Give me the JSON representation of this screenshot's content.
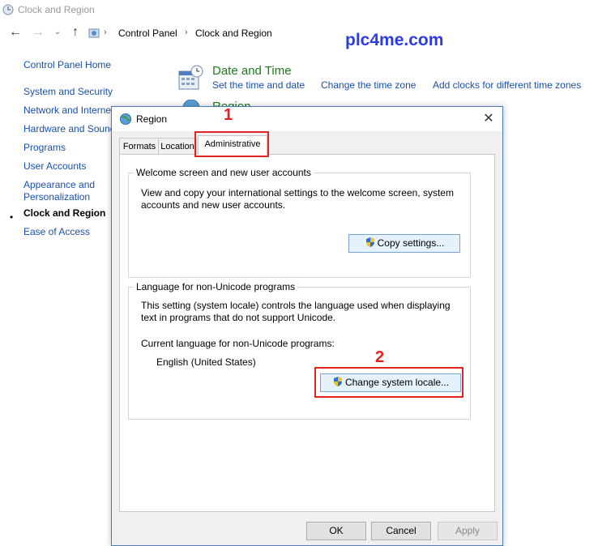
{
  "window": {
    "title": "Clock and Region"
  },
  "address": {
    "crumbs": [
      "Control Panel",
      "Clock and Region"
    ]
  },
  "watermark": "plc4me.com",
  "left_nav": {
    "home": "Control Panel Home",
    "items": [
      {
        "label": "System and Security"
      },
      {
        "label": "Network and Internet"
      },
      {
        "label": "Hardware and Sound"
      },
      {
        "label": "Programs"
      },
      {
        "label": "User Accounts"
      },
      {
        "label": "Appearance and"
      },
      {
        "label": "Personalization"
      },
      {
        "label": "Clock and Region"
      },
      {
        "label": "Ease of Access"
      }
    ],
    "active_bullet": "•"
  },
  "main": {
    "date_time": {
      "title": "Date and Time",
      "links": [
        "Set the time and date",
        "Change the time zone",
        "Add clocks for different time zones"
      ]
    },
    "region_title": "Region"
  },
  "dialog": {
    "title": "Region",
    "tabs": [
      "Formats",
      "Location",
      "Administrative"
    ],
    "welcome": {
      "legend": "Welcome screen and new user accounts",
      "desc_line1": "View and copy your international settings to the welcome screen, system",
      "desc_line2": "accounts and new user accounts.",
      "button": "Copy settings..."
    },
    "unicode": {
      "legend": "Language for non-Unicode programs",
      "desc_line1": "This setting (system locale) controls the language used when displaying",
      "desc_line2": "text in programs that do not support Unicode.",
      "current_label": "Current language for non-Unicode programs:",
      "current_value": "English (United States)",
      "button": "Change system locale..."
    },
    "buttons": {
      "ok": "OK",
      "cancel": "Cancel",
      "apply": "Apply"
    }
  },
  "annotations": {
    "step1": "1",
    "step2": "2",
    "color": "#e02424"
  }
}
